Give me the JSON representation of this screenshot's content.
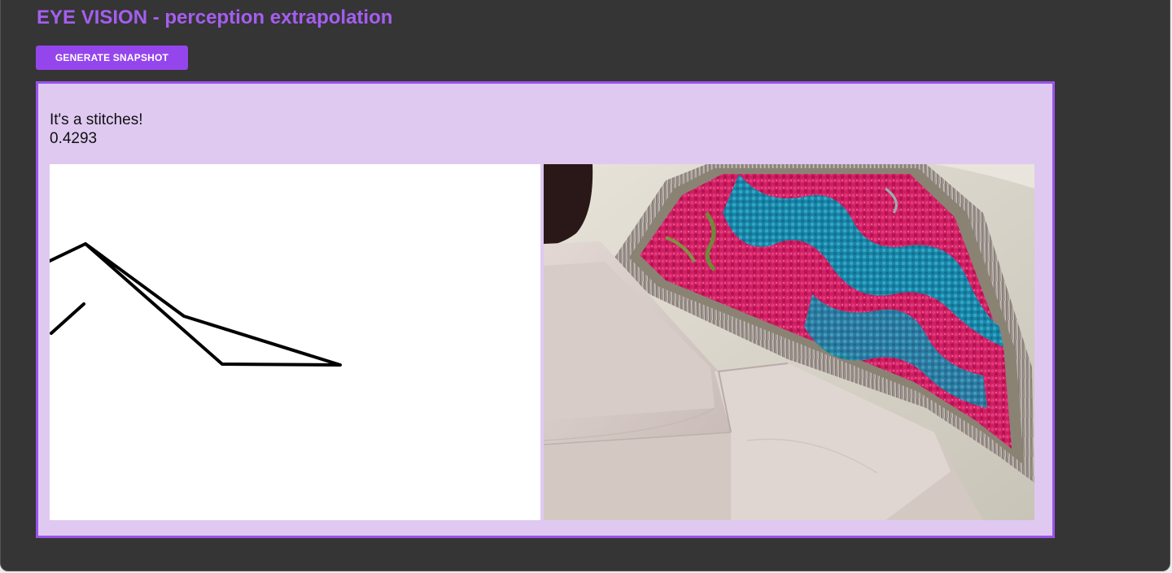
{
  "header": {
    "title": "EYE VISION - perception extrapolation"
  },
  "toolbar": {
    "generate_label": "GENERATE SNAPSHOT"
  },
  "result": {
    "label": "It's a stitches!",
    "score": "0.4293"
  },
  "drawing_canvas": {
    "stroke_color": "#000000"
  },
  "generated_image": {
    "subject": "embroidered fringed textile on folded linen cloth",
    "palette": [
      "#d6155e",
      "#1c93b4",
      "#8a8370",
      "#d9cfca",
      "#2a1c1c"
    ]
  },
  "colors": {
    "background": "#353535",
    "accent": "#9446ec",
    "title": "#a55ef0",
    "panel": "#dfc9f1",
    "panel_border": "#9a52ea"
  }
}
